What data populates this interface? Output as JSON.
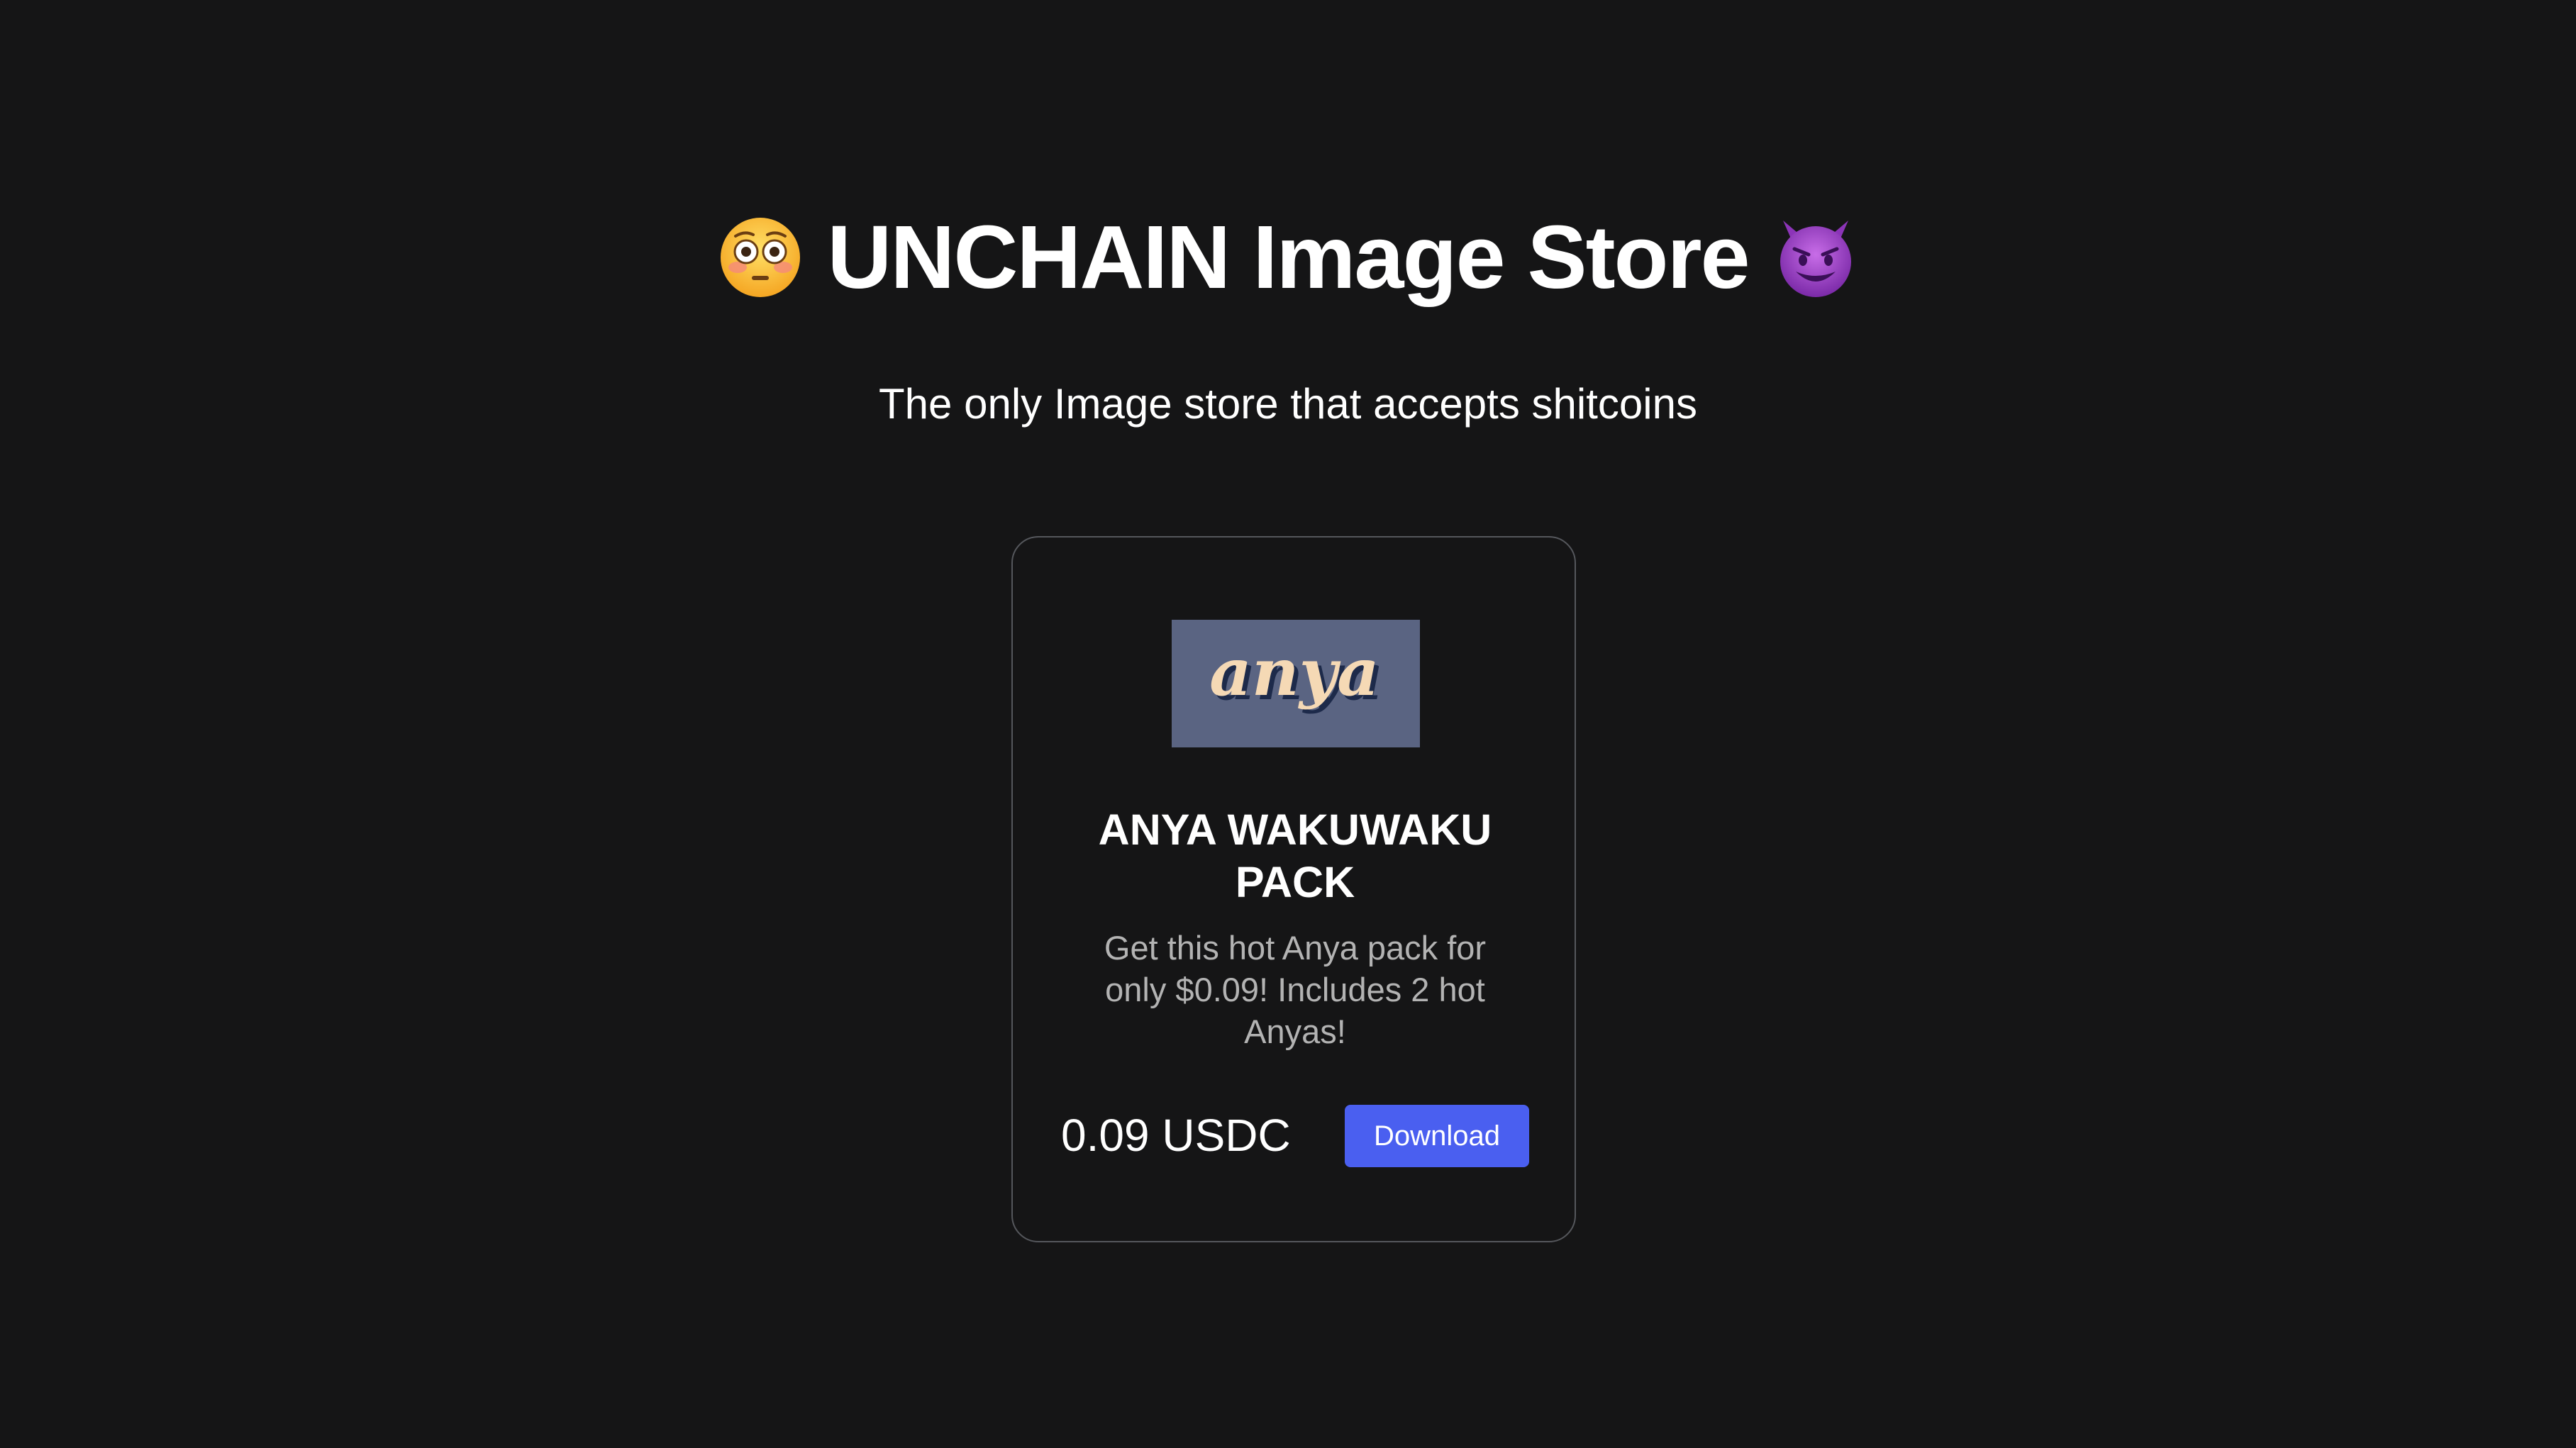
{
  "header": {
    "title": "UNCHAIN Image Store",
    "left_emoji": "flushed-face",
    "right_emoji": "smiling-face-with-horns"
  },
  "subtitle": "The only Image store that accepts shitcoins",
  "product": {
    "image_text": "anya",
    "name": "ANYA WAKUWAKU PACK",
    "description": "Get this hot Anya pack for only $0.09! Includes 2 hot Anyas!",
    "price": "0.09 USDC",
    "button_label": "Download"
  },
  "colors": {
    "background": "#151516",
    "card_border": "#55575c",
    "button": "#4a5ff0",
    "image_bg": "#5a6482",
    "image_text": "#f5d9b5",
    "image_shadow": "#1d2a4a",
    "description": "#b3b3b3"
  }
}
